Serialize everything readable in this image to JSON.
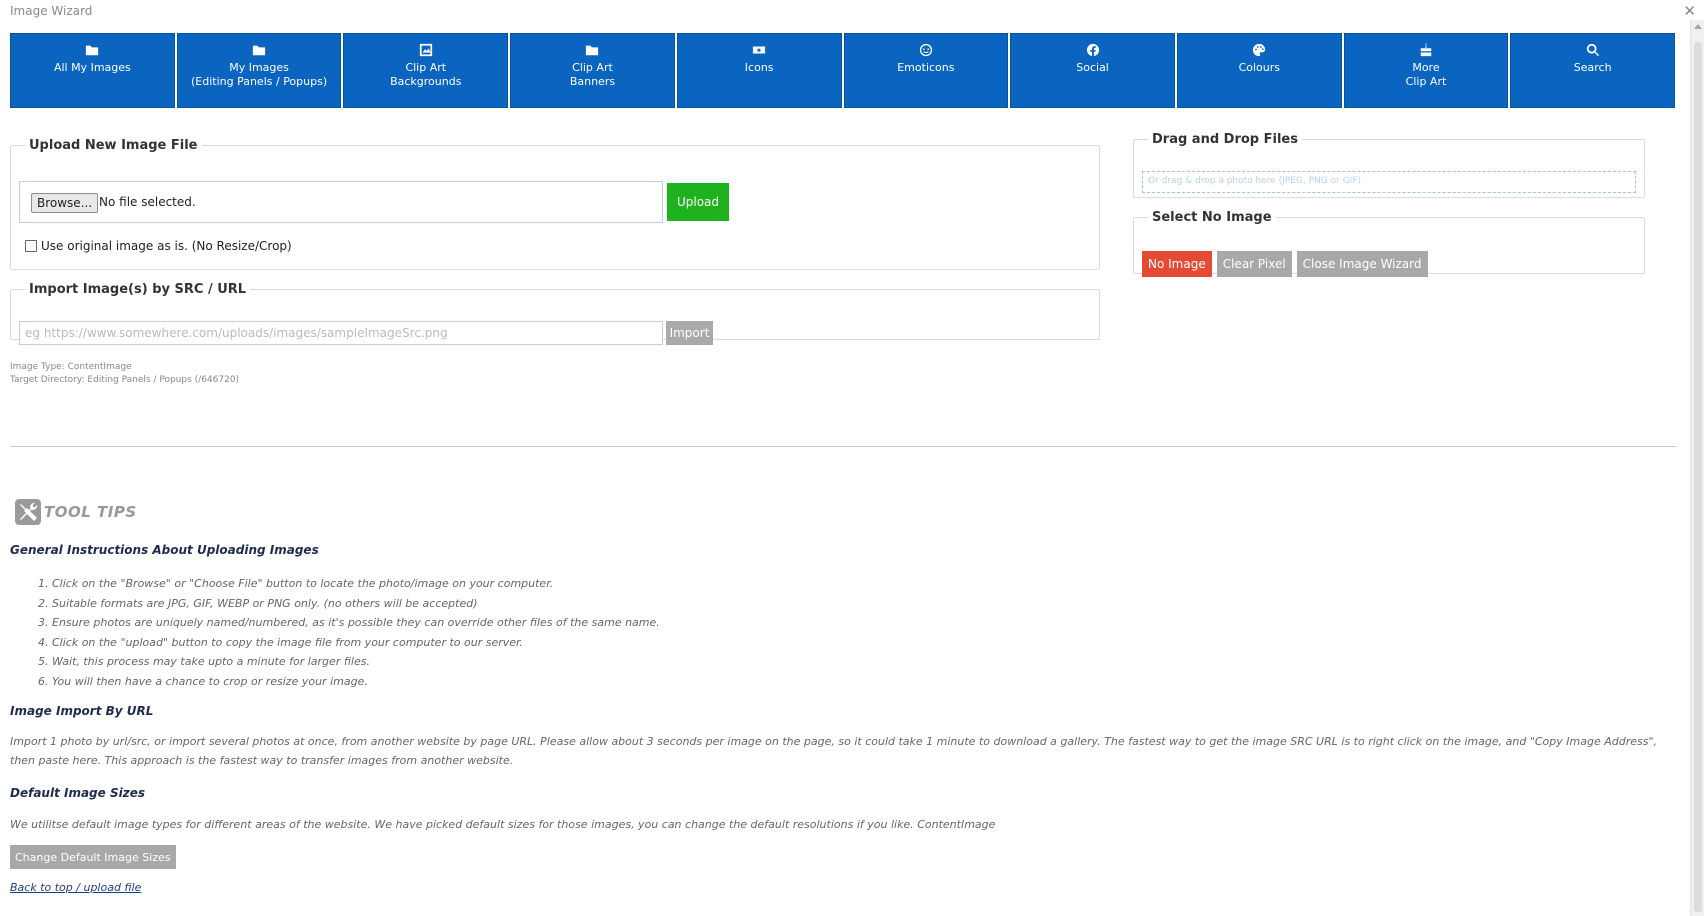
{
  "window": {
    "title": "Image Wizard",
    "close_glyph": "✕"
  },
  "nav": [
    {
      "icon": "folder-icon",
      "label": "All My Images"
    },
    {
      "icon": "folder-icon",
      "label": "My Images\n(Editing Panels / Popups)"
    },
    {
      "icon": "image-frame-icon",
      "label": "Clip Art\nBackgrounds"
    },
    {
      "icon": "folder-icon",
      "label": "Clip Art\nBanners"
    },
    {
      "icon": "ticket-icon",
      "label": "Icons"
    },
    {
      "icon": "smiley-icon",
      "label": "Emoticons"
    },
    {
      "icon": "facebook-icon",
      "label": "Social"
    },
    {
      "icon": "palette-icon",
      "label": "Colours"
    },
    {
      "icon": "cake-icon",
      "label": "More\nClip Art"
    },
    {
      "icon": "search-icon",
      "label": "Search"
    }
  ],
  "upload": {
    "legend": "Upload New Image File",
    "browse_label": "Browse...",
    "file_status": "No file selected.",
    "upload_label": "Upload",
    "checkbox_label": "Use original image as is. (No Resize/Crop)"
  },
  "import": {
    "legend": "Import Image(s) by SRC / URL",
    "placeholder": "eg https://www.somewhere.com/uploads/images/sampleImageSrc.png",
    "button_label": "Import"
  },
  "meta": {
    "image_type": "Image Type: ContentImage",
    "target_dir": "Target Directory: Editing Panels / Popups (/646720)"
  },
  "drag": {
    "legend": "Drag and Drop Files",
    "drop_text": "Or drag & drop a photo here (JPEG, PNG or GIF)"
  },
  "no_image": {
    "legend": "Select No Image",
    "no_image_label": "No Image",
    "clear_pixel_label": "Clear Pixel",
    "close_label": "Close Image Wizard"
  },
  "tips": {
    "title": "TOOL TIPS",
    "general_heading": "General Instructions About Uploading Images",
    "steps": [
      "1. Click on the \"Browse\" or \"Choose File\" button to locate the photo/image on your computer.",
      "2. Suitable formats are JPG, GIF, WEBP or PNG only. (no others will be accepted)",
      "3. Ensure photos are uniquely named/numbered, as it's possible they can override other files of the same name.",
      "4. Click on the \"upload\" button to copy the image file from your computer to our server.",
      "5. Wait, this process may take upto a minute for larger files.",
      "6. You will then have a chance to crop or resize your image."
    ],
    "import_heading": "Image Import By URL",
    "import_text": "Import 1 photo by url/src, or import several photos at once, from another website by page URL. Please allow about 3 seconds per image on the page, so it could take 1 minute to download a gallery. The fastest way to get the image SRC URL is to right click on the image, and \"Copy Image Address\", then paste here. This approach is the fastest way to transfer images from another website.",
    "sizes_heading": "Default Image Sizes",
    "sizes_text": "We utilitse default image types for different areas of the website. We have picked default sizes for those images, you can change the default resolutions if you like. ContentImage",
    "change_sizes_label": "Change Default Image Sizes",
    "back_link": "Back to top / upload file"
  },
  "colors": {
    "nav_blue": "#0a64c0",
    "upload_green": "#1fb21f",
    "no_image_red": "#e54b34",
    "grey_button": "#a8a8a8"
  }
}
